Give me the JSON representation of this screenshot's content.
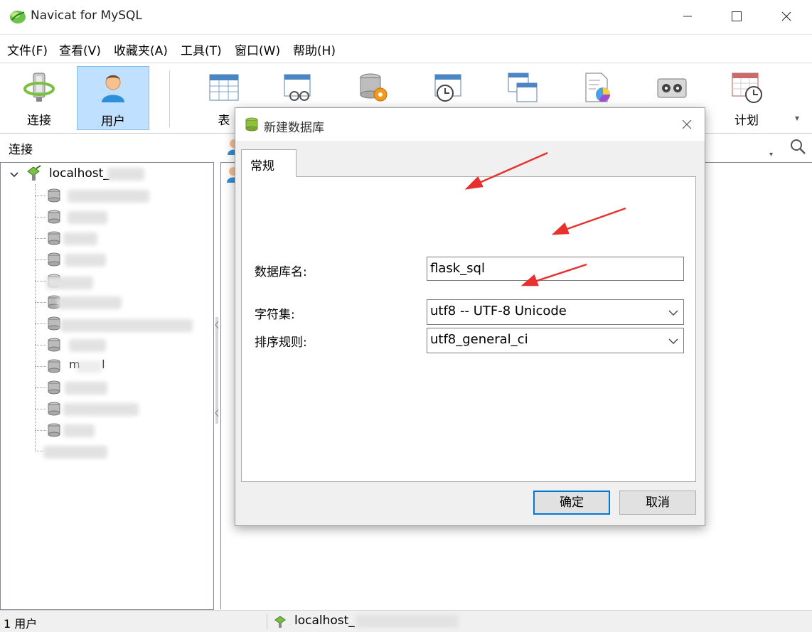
{
  "window": {
    "title": "Navicat for MySQL"
  },
  "menu": {
    "items": [
      "文件(F)",
      "查看(V)",
      "收藏夹(A)",
      "工具(T)",
      "窗口(W)",
      "帮助(H)"
    ]
  },
  "toolbar": {
    "connect_label": "连接",
    "user_label": "用户",
    "table_label": "表",
    "schedule_label": "计划",
    "icons": [
      "plug-icon",
      "user-icon",
      "table-icon",
      "view-icon",
      "function-icon",
      "event-icon",
      "query-icon",
      "report-icon",
      "backup-icon",
      "schedule-icon"
    ]
  },
  "sidebar": {
    "header": "连接",
    "connection_name": "localhost_"
  },
  "tree": {
    "redacted_item_text": "m      l"
  },
  "dialog": {
    "title": "新建数据库",
    "tab": "常规",
    "fields": {
      "db_name_label": "数据库名:",
      "db_name_value": "flask_sql",
      "charset_label": "字符集:",
      "charset_value": "utf8 -- UTF-8 Unicode",
      "collation_label": "排序规则:",
      "collation_value": "utf8_general_ci"
    },
    "ok_label": "确定",
    "cancel_label": "取消"
  },
  "status": {
    "count": "1 用户",
    "connection": "localhost_"
  },
  "colors": {
    "selection": "#bfe0ff",
    "focus_border": "#0078d7",
    "annotation_arrow": "#e8312f"
  }
}
